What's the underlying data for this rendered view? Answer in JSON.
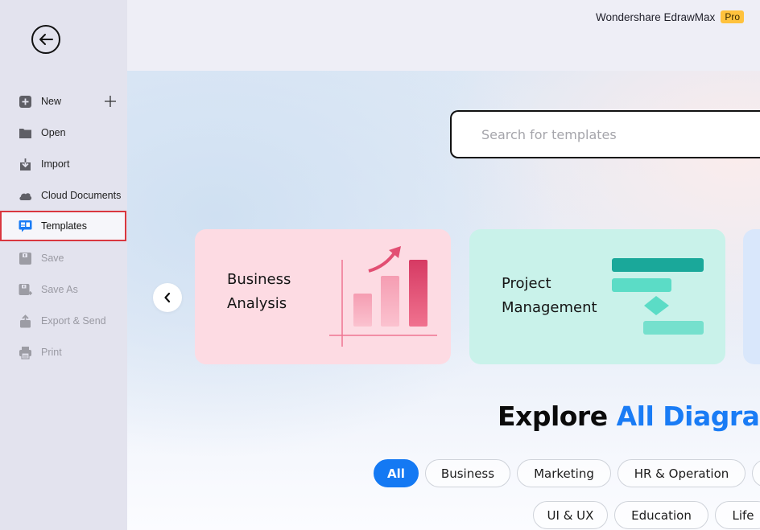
{
  "app": {
    "brand_name": "Wondershare EdrawMax",
    "badge": "Pro"
  },
  "sidebar": {
    "back_icon": "arrow-left-circle-icon",
    "items": [
      {
        "label": "New",
        "icon": "plus-square-icon",
        "state": "normal"
      },
      {
        "label": "Open",
        "icon": "folder-icon",
        "state": "normal"
      },
      {
        "label": "Import",
        "icon": "import-icon",
        "state": "normal"
      },
      {
        "label": "Cloud Documents",
        "icon": "cloud-icon",
        "state": "normal"
      },
      {
        "label": "Templates",
        "icon": "templates-icon",
        "state": "selected"
      },
      {
        "label": "Save",
        "icon": "save-icon",
        "state": "disabled"
      },
      {
        "label": "Save As",
        "icon": "save-as-icon",
        "state": "disabled"
      },
      {
        "label": "Export & Send",
        "icon": "export-icon",
        "state": "disabled"
      },
      {
        "label": "Print",
        "icon": "print-icon",
        "state": "disabled"
      }
    ]
  },
  "search": {
    "placeholder": "Search for templates",
    "value": ""
  },
  "carousel": {
    "cards": [
      {
        "title": "Business\nAnalysis",
        "color": "#fddbe3"
      },
      {
        "title": "Project\nManagement",
        "color": "#c9f2ea"
      },
      {
        "title": "",
        "color": "#d9e7fb"
      }
    ]
  },
  "explore": {
    "heading_dark": "Explore",
    "heading_blue": "All Diagra"
  },
  "categories": [
    {
      "label": "All",
      "active": true
    },
    {
      "label": "Business",
      "active": false
    },
    {
      "label": "Marketing",
      "active": false
    },
    {
      "label": "HR & Operation",
      "active": false
    },
    {
      "label": "",
      "active": false
    },
    {
      "label": "UI & UX",
      "active": false
    },
    {
      "label": "Education",
      "active": false
    },
    {
      "label": "Life",
      "active": false
    }
  ],
  "colors": {
    "accent_blue": "#1479f3",
    "selected_outline": "#d9373f",
    "pro_badge": "#ffc23d"
  }
}
